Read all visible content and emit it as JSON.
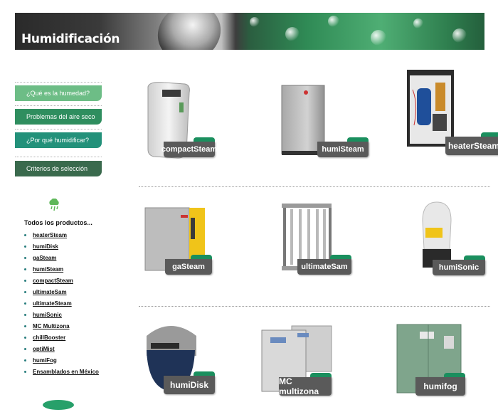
{
  "banner": {
    "title": "Humidificación"
  },
  "menu": [
    {
      "label": "¿Qué es la humedad?",
      "color": "#6dbd86"
    },
    {
      "label": "Problemas del aire seco",
      "color": "#2f8e5f"
    },
    {
      "label": "¿Por qué humidificar?",
      "color": "#23917a"
    },
    {
      "label": "Criterios de selección",
      "color": "#3a6a4d"
    }
  ],
  "products_list": {
    "title": "Todos los productos...",
    "items": [
      "heaterSteam",
      "humiDisk",
      "gaSteam",
      "humiSteam",
      "compactSteam",
      "ultimateSam",
      "ultimateSteam",
      "humiSonic",
      "MC Multizona",
      "chillBooster",
      "optiMist",
      "humiFog",
      "Ensamblados en México"
    ]
  },
  "grid": [
    {
      "label": "compactSteam"
    },
    {
      "label": "humiSteam"
    },
    {
      "label": "heaterSteam"
    },
    {
      "label": "gaSteam"
    },
    {
      "label": "ultimateSam"
    },
    {
      "label": "humiSonic"
    },
    {
      "label": "humiDisk"
    },
    {
      "label": "MC multizona"
    },
    {
      "label": "humifog"
    }
  ],
  "colors": {
    "accent_green": "#1a8f5e",
    "badge_gray": "#5a5a5a"
  }
}
